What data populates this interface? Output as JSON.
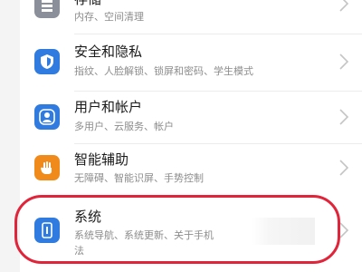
{
  "settings": {
    "storage": {
      "title": "存储",
      "subtitle": "内存、空间清理",
      "icon": "storage-icon"
    },
    "security": {
      "title": "安全和隐私",
      "subtitle": "指纹、人脸解锁、锁屏和密码、学生模式",
      "icon": "shield-icon"
    },
    "accounts": {
      "title": "用户和帐户",
      "subtitle": "多用户、云服务、帐户",
      "icon": "user-icon"
    },
    "assist": {
      "title": "智能辅助",
      "subtitle": "无障碍、智能识屏、手势控制",
      "icon": "hand-icon"
    },
    "system": {
      "title": "系统",
      "subtitle_line1": "系统导航、系统更新、关于手机",
      "subtitle_line2": "法",
      "icon": "phone-info-icon"
    }
  },
  "colors": {
    "storage": "#8a8f99",
    "security": "#2f7be0",
    "accounts": "#2f7be0",
    "assist": "#f08a1a",
    "system": "#2f7be0",
    "highlight": "#e0243a"
  }
}
